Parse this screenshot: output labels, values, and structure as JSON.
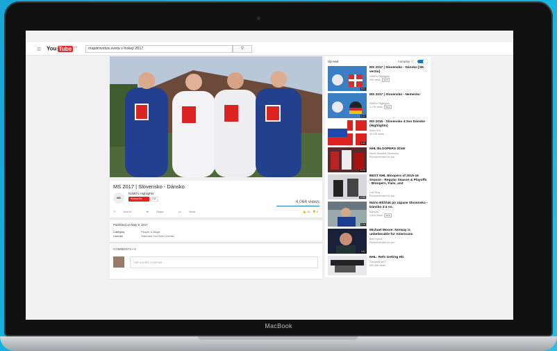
{
  "device": {
    "brand": "MacBook"
  },
  "topbar": {
    "logo_you": "You",
    "logo_tube": "Tube",
    "logo_cc": "SK",
    "search_value": "majstrovstva sveta v hokeji 2017",
    "search_icon": "search-icon"
  },
  "video": {
    "title": "MS 2017 | Slovensko - Dánsko",
    "owner_avatar_text": "NS",
    "owner": "N3M0's Highlights",
    "subscribe": "Subscribe",
    "subscriber_count": "230",
    "views": "4,064 views",
    "actions": {
      "add": "Add to",
      "share": "Share",
      "more": "More"
    },
    "likes": "15",
    "dislikes": "0"
  },
  "meta": {
    "published": "Published on May 9, 2017",
    "category_label": "Category",
    "category_value": "People & Blogs",
    "license_label": "License",
    "license_value": "Standard YouTube License"
  },
  "comments": {
    "count": "COMMENTS • 0",
    "placeholder": "Add a public comment..."
  },
  "sidebar": {
    "up_next": "Up next",
    "autoplay": "Autoplay",
    "items": [
      {
        "title": "MS 2017 | Slovensko - Dánsko [SK verzia]",
        "channel": "N3M0's Highlights",
        "meta": "905 views",
        "badge": "NEW",
        "duration": "5:01"
      },
      {
        "title": "MS 2017 | Slovensko - Nemecko",
        "channel": "N3M0's Highlights",
        "meta": "1,176 views",
        "badge": "NEW",
        "duration": "4:22"
      },
      {
        "title": "MS 2015 - Slovensko 4:3sn Dánsko (Highlights)",
        "channel": "Mário Kriš",
        "meta": "30,938 views",
        "badge": "",
        "duration": "6:45"
      },
      {
        "title": "NHL BLOOPERS 2016!",
        "channel": "Marek Mesiarik Slovensko",
        "meta": "Recommended for you",
        "badge": "",
        "duration": "10:25"
      },
      {
        "title": "BEST NHL Bloopers of 2015-16 Season - Regular Season & Playoffs - Bloopers, Fails, and",
        "channel": "Lost King",
        "meta": "Recommended for you",
        "badge": "",
        "duration": "10:58"
      },
      {
        "title": "Mário Bližňák po zápase Slovensko - Dánsko 3:4 sn.",
        "channel": "hokej.sk",
        "meta": "1,844 views",
        "badge": "NEW",
        "duration": "2:24"
      },
      {
        "title": "Michael Moore: Norway is unbelievable for Americans",
        "channel": "Berit Nyrud",
        "meta": "Recommended for you",
        "badge": "",
        "duration": "3:42"
      },
      {
        "title": "NHL: Refs Getting Hit",
        "channel": "CanucksFan27",
        "meta": "690,346 views",
        "badge": "",
        "duration": ""
      }
    ]
  }
}
